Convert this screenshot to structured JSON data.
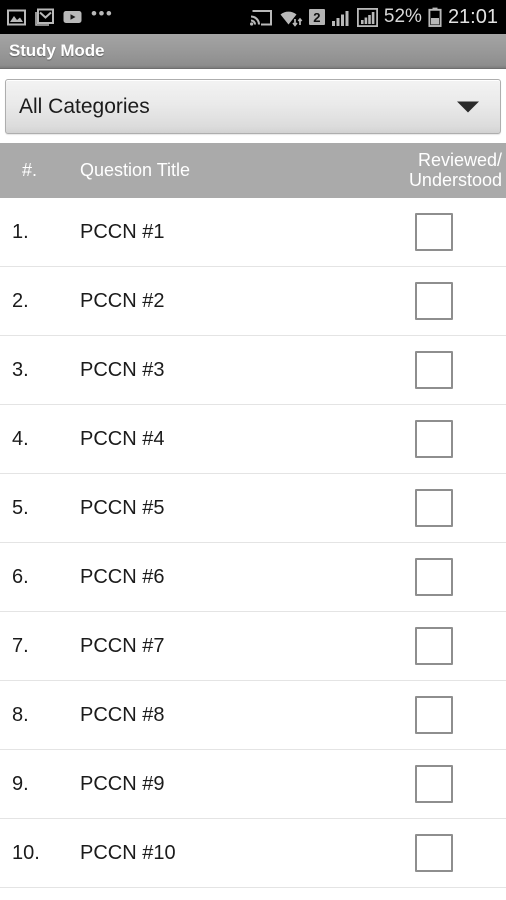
{
  "status_bar": {
    "left_icons": [
      "image-icon",
      "gmail-icon",
      "youtube-icon",
      "more-notifications-icon"
    ],
    "more_glyph": "•••",
    "cast_icon": "cast-icon",
    "wifi_icon": "wifi-icon",
    "sim_badge": "2",
    "signal_icons": [
      "signal-bars-icon",
      "signal-bars-boxed-icon"
    ],
    "battery_percent": "52%",
    "battery_icon": "battery-icon",
    "time": "21:01"
  },
  "action_bar": {
    "title": "Study Mode"
  },
  "category_spinner": {
    "selected": "All Categories",
    "arrow_icon": "chevron-down-icon"
  },
  "table": {
    "headers": {
      "number": "#.",
      "title": "Question Title",
      "reviewed": "Reviewed/\nUnderstood"
    },
    "rows": [
      {
        "number": "1.",
        "title": "PCCN #1",
        "checked": false
      },
      {
        "number": "2.",
        "title": "PCCN #2",
        "checked": false
      },
      {
        "number": "3.",
        "title": "PCCN #3",
        "checked": false
      },
      {
        "number": "4.",
        "title": "PCCN #4",
        "checked": false
      },
      {
        "number": "5.",
        "title": "PCCN #5",
        "checked": false
      },
      {
        "number": "6.",
        "title": "PCCN #6",
        "checked": false
      },
      {
        "number": "7.",
        "title": "PCCN #7",
        "checked": false
      },
      {
        "number": "8.",
        "title": "PCCN #8",
        "checked": false
      },
      {
        "number": "9.",
        "title": "PCCN #9",
        "checked": false
      },
      {
        "number": "10.",
        "title": "PCCN #10",
        "checked": false
      }
    ]
  },
  "colors": {
    "status_bar_bg": "#000000",
    "action_bar_bg": "#949494",
    "table_header_bg": "#aaaaaa",
    "row_divider": "#e4e4e4",
    "checkbox_border": "#8e8e8e"
  }
}
